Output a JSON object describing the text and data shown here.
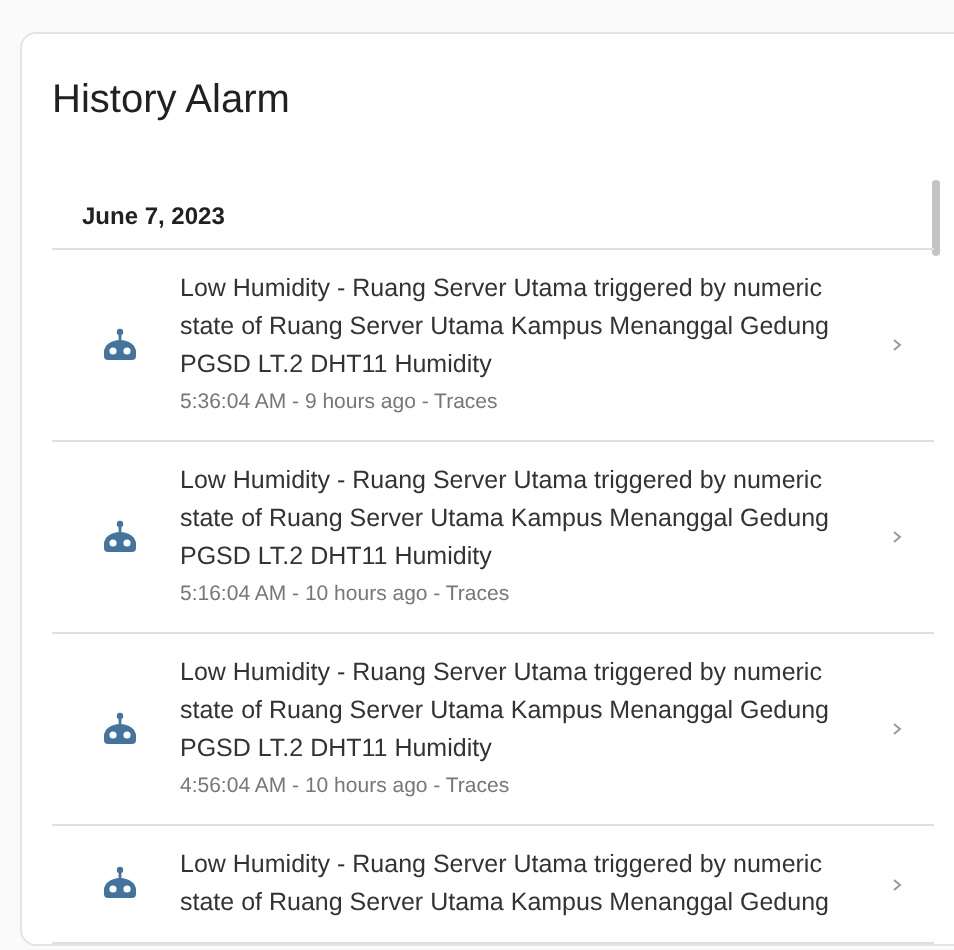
{
  "card": {
    "title": "History Alarm"
  },
  "groups": [
    {
      "date": "June 7, 2023",
      "entries": [
        {
          "message": "Low Humidity - Ruang Server Utama triggered by numeric state of Ruang Server Utama Kampus Menanggal Gedung PGSD LT.2 DHT11 Humidity",
          "time": "5:36:04 AM - 9 hours ago - Traces"
        },
        {
          "message": "Low Humidity - Ruang Server Utama triggered by numeric state of Ruang Server Utama Kampus Menanggal Gedung PGSD LT.2 DHT11 Humidity",
          "time": "5:16:04 AM - 10 hours ago - Traces"
        },
        {
          "message": "Low Humidity - Ruang Server Utama triggered by numeric state of Ruang Server Utama Kampus Menanggal Gedung PGSD LT.2 DHT11 Humidity",
          "time": "4:56:04 AM - 10 hours ago - Traces"
        },
        {
          "message": "Low Humidity - Ruang Server Utama triggered by numeric state of Ruang Server Utama Kampus Menanggal Gedung"
        }
      ]
    }
  ]
}
